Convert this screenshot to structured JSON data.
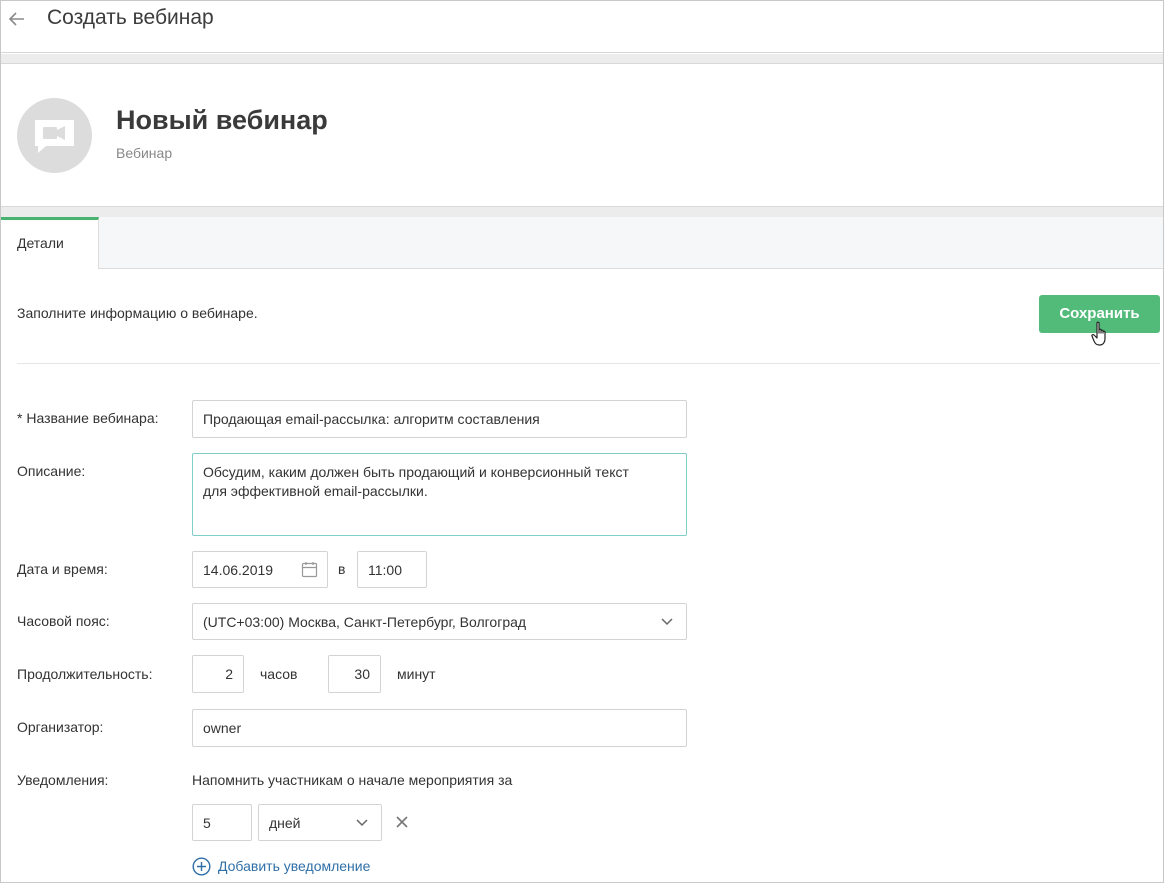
{
  "header": {
    "title": "Создать вебинар"
  },
  "profile": {
    "name": "Новый вебинар",
    "type": "Вебинар"
  },
  "tabs": [
    {
      "label": "Детали"
    }
  ],
  "intro": "Заполните информацию о вебинаре.",
  "save_label": "Сохранить",
  "form": {
    "name_label": "* Название вебинара:",
    "name_value": "Продающая email-рассылка: алгоритм составления",
    "description_label": "Описание:",
    "description_value": "Обсудим, каким должен быть продающий и конверсионный текст\nдля эффективной email-рассылки.",
    "datetime_label": "Дата и время:",
    "date_value": "14.06.2019",
    "at_text": "в",
    "time_value": "11:00",
    "timezone_label": "Часовой пояс:",
    "timezone_value": "(UTC+03:00) Москва, Санкт-Петербург, Волгоград",
    "duration_label": "Продолжительность:",
    "hours_value": "2",
    "hours_unit": "часов",
    "minutes_value": "30",
    "minutes_unit": "минут",
    "organizer_label": "Организатор:",
    "organizer_value": "owner",
    "notifications_label": "Уведомления:",
    "notifications_text": "Напомнить участникам о начале мероприятия за",
    "notify_amount": "5",
    "notify_unit": "дней",
    "add_notification": "Добавить уведомление"
  },
  "colors": {
    "accent": "#52bb7a",
    "tab_indicator": "#48b36f",
    "link": "#2f6fa8",
    "focus": "#7fcfc9"
  }
}
